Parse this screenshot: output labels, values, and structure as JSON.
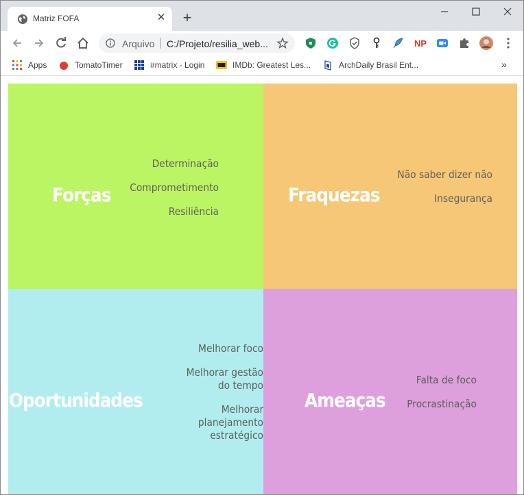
{
  "browser": {
    "tab_title": "Matriz FOFA",
    "new_tab": "+",
    "address_label": "Arquivo",
    "address_url": "C:/Projeto/resilia_web...",
    "bookmarks": [
      {
        "label": "Apps",
        "icon": "apps-grid-icon"
      },
      {
        "label": "TomatoTimer",
        "icon": "tomato-icon"
      },
      {
        "label": "#matrix - Login",
        "icon": "matrix-icon"
      },
      {
        "label": "IMDb: Greatest Les...",
        "icon": "imdb-icon"
      },
      {
        "label": "ArchDaily Brasil Ent...",
        "icon": "archdaily-icon"
      }
    ],
    "bookmarks_more": "»",
    "extensions": [
      "shield-icon",
      "grammarly-icon",
      "shield-check-icon",
      "key-icon",
      "feather-icon",
      "np-icon",
      "zoom-icon",
      "puzzle-icon",
      "avatar"
    ],
    "np_label": "NP"
  },
  "colors": {
    "forcas": "#bbf564",
    "fraquezas": "#f5c776",
    "oportunidades": "#b1edee",
    "ameacas": "#dda0dd"
  },
  "matrix": {
    "forcas": {
      "title": "Forças",
      "items": [
        "Determinação",
        "Comprometimento",
        "Resiliência"
      ]
    },
    "fraquezas": {
      "title": "Fraquezas",
      "items": [
        "Não saber dizer não",
        "Insegurança"
      ]
    },
    "oportunidades": {
      "title": "Oportunidades",
      "items": [
        "Melhorar foco",
        "Melhorar gestão do tempo",
        "Melhorar planejamento estratégico"
      ]
    },
    "ameacas": {
      "title": "Ameaças",
      "items": [
        "Falta de foco",
        "Procrastinação"
      ]
    }
  }
}
